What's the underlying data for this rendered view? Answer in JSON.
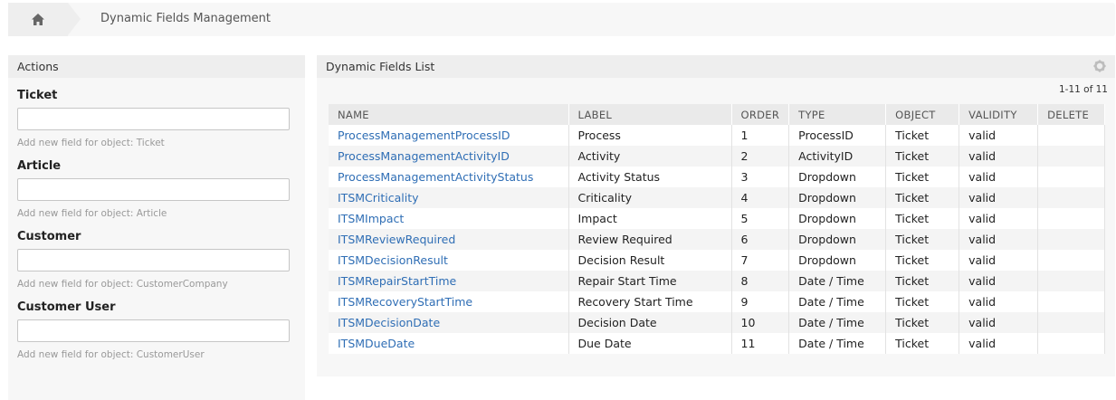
{
  "breadcrumb": {
    "home_icon": "home-icon",
    "current": "Dynamic Fields Management"
  },
  "sidebar": {
    "title": "Actions",
    "groups": [
      {
        "title": "Ticket",
        "hint": "Add new field for object: Ticket"
      },
      {
        "title": "Article",
        "hint": "Add new field for object: Article"
      },
      {
        "title": "Customer",
        "hint": "Add new field for object: CustomerCompany"
      },
      {
        "title": "Customer User",
        "hint": "Add new field for object: CustomerUser"
      }
    ]
  },
  "panel": {
    "title": "Dynamic Fields List",
    "settings_icon": "gear-icon",
    "pager": "1-11 of 11",
    "columns": [
      "NAME",
      "LABEL",
      "ORDER",
      "TYPE",
      "OBJECT",
      "VALIDITY",
      "DELETE"
    ],
    "rows": [
      {
        "name": "ProcessManagementProcessID",
        "label": "Process",
        "order": "1",
        "type": "ProcessID",
        "object": "Ticket",
        "validity": "valid",
        "delete": ""
      },
      {
        "name": "ProcessManagementActivityID",
        "label": "Activity",
        "order": "2",
        "type": "ActivityID",
        "object": "Ticket",
        "validity": "valid",
        "delete": ""
      },
      {
        "name": "ProcessManagementActivityStatus",
        "label": "Activity Status",
        "order": "3",
        "type": "Dropdown",
        "object": "Ticket",
        "validity": "valid",
        "delete": ""
      },
      {
        "name": "ITSMCriticality",
        "label": "Criticality",
        "order": "4",
        "type": "Dropdown",
        "object": "Ticket",
        "validity": "valid",
        "delete": ""
      },
      {
        "name": "ITSMImpact",
        "label": "Impact",
        "order": "5",
        "type": "Dropdown",
        "object": "Ticket",
        "validity": "valid",
        "delete": ""
      },
      {
        "name": "ITSMReviewRequired",
        "label": "Review Required",
        "order": "6",
        "type": "Dropdown",
        "object": "Ticket",
        "validity": "valid",
        "delete": ""
      },
      {
        "name": "ITSMDecisionResult",
        "label": "Decision Result",
        "order": "7",
        "type": "Dropdown",
        "object": "Ticket",
        "validity": "valid",
        "delete": ""
      },
      {
        "name": "ITSMRepairStartTime",
        "label": "Repair Start Time",
        "order": "8",
        "type": "Date / Time",
        "object": "Ticket",
        "validity": "valid",
        "delete": ""
      },
      {
        "name": "ITSMRecoveryStartTime",
        "label": "Recovery Start Time",
        "order": "9",
        "type": "Date / Time",
        "object": "Ticket",
        "validity": "valid",
        "delete": ""
      },
      {
        "name": "ITSMDecisionDate",
        "label": "Decision Date",
        "order": "10",
        "type": "Date / Time",
        "object": "Ticket",
        "validity": "valid",
        "delete": ""
      },
      {
        "name": "ITSMDueDate",
        "label": "Due Date",
        "order": "11",
        "type": "Date / Time",
        "object": "Ticket",
        "validity": "valid",
        "delete": ""
      }
    ]
  },
  "colors": {
    "link": "#2f6eb5",
    "panel_bg": "#f7f7f7",
    "header_bg": "#eeeeee"
  }
}
